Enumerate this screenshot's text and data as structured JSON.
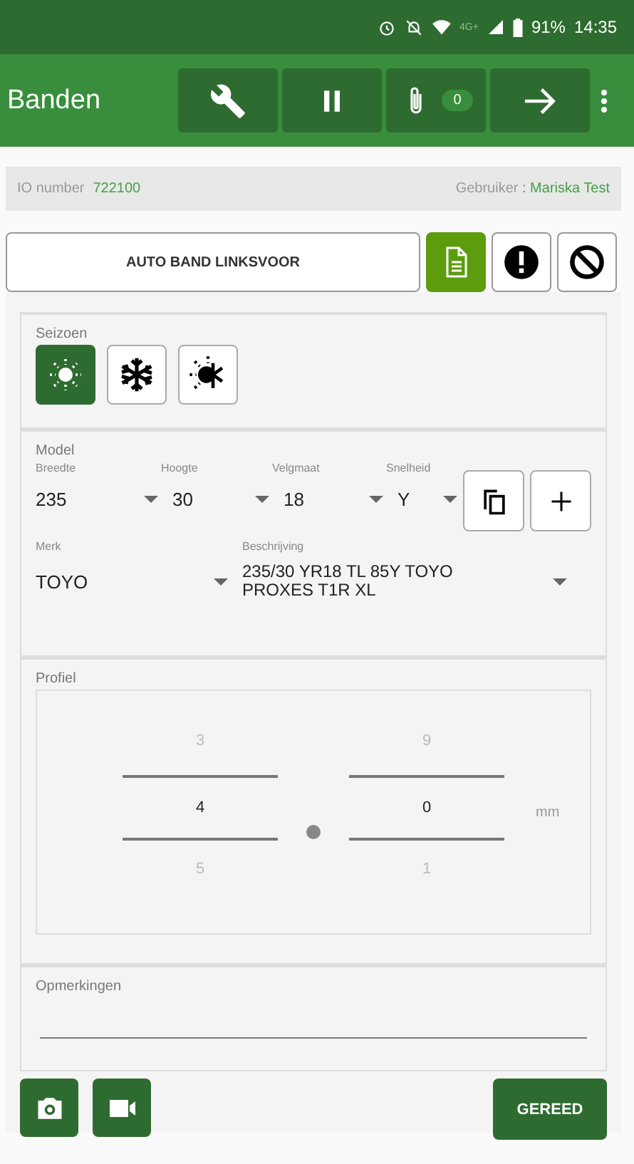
{
  "status_bar": {
    "network": "4G+",
    "battery": "91%",
    "time": "14:35"
  },
  "app_bar": {
    "title": "Banden",
    "actions": [
      {
        "kind": "wrench"
      },
      {
        "kind": "pause"
      },
      {
        "kind": "attach",
        "count": "0"
      },
      {
        "kind": "next"
      }
    ]
  },
  "info": {
    "io_label": "IO number",
    "io_value": "722100",
    "user_label": "Gebruiker",
    "user_value": ": Mariska Test"
  },
  "tire": {
    "label": "AUTO BAND LINKSVOOR",
    "actions": [
      {
        "kind": "document",
        "selected": true
      },
      {
        "kind": "alert",
        "selected": false
      },
      {
        "kind": "block",
        "selected": false
      }
    ]
  },
  "season": {
    "label": "Seizoen",
    "options": [
      {
        "kind": "summer",
        "selected": true
      },
      {
        "kind": "winter",
        "selected": false
      },
      {
        "kind": "all_season",
        "selected": false
      }
    ]
  },
  "model": {
    "label": "Model",
    "sizes": [
      {
        "label": "Breedte",
        "value": "235"
      },
      {
        "label": "Hoogte",
        "value": "30"
      },
      {
        "label": "Velgmaat",
        "value": "18"
      },
      {
        "label": "Snelheid",
        "value": "Y"
      }
    ],
    "brand": {
      "label": "Merk",
      "value": "TOYO"
    },
    "description": {
      "label": "Beschrijving",
      "value": "235/30 YR18 TL 85Y  TOYO PROXES T1R XL"
    }
  },
  "profile": {
    "label": "Profiel",
    "wheels": [
      {
        "above": "3",
        "value": "4",
        "below": "5"
      },
      {
        "above": "9",
        "value": "0",
        "below": "1"
      }
    ],
    "unit": "mm"
  },
  "remarks": {
    "label": "Opmerkingen"
  },
  "footer": {
    "media": [
      {
        "kind": "camera"
      },
      {
        "kind": "video"
      }
    ],
    "done": "GEREED"
  }
}
